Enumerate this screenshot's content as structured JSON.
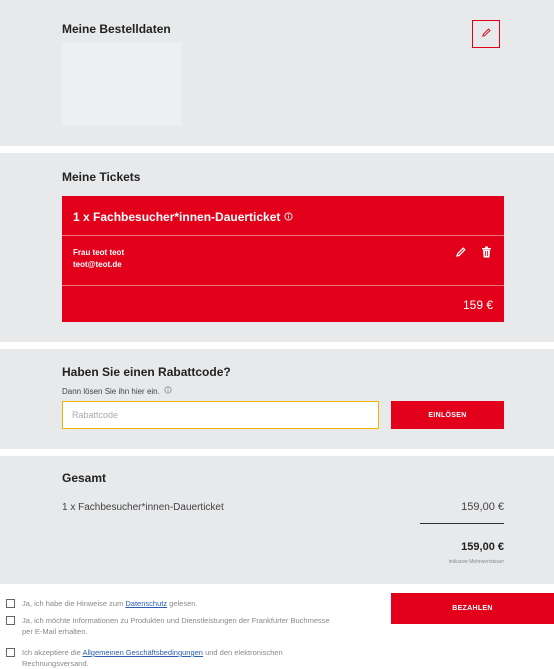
{
  "order_data": {
    "title": "Meine Bestelldaten",
    "edit_icon": "pencil-icon"
  },
  "tickets": {
    "title": "Meine Tickets",
    "ticket_name": "1 x Fachbesucher*innen-Dauerticket",
    "info_icon": "info-icon",
    "attendee_name": "Frau teot teot",
    "attendee_email": "teot@teot.de",
    "price": "159 €",
    "edit_icon": "pencil-icon",
    "delete_icon": "trash-icon"
  },
  "discount": {
    "title": "Haben Sie einen Rabattcode?",
    "subtitle": "Dann lösen Sie ihn hier ein.",
    "placeholder": "Rabattcode",
    "button_label": "EINLÖSEN"
  },
  "total": {
    "title": "Gesamt",
    "line_item": "1 x Fachbesucher*innen-Dauerticket",
    "line_price": "159,00 €",
    "sum": "159,00 €",
    "tax_note": "inklusive Mehrwertsteuer"
  },
  "consents": [
    {
      "before": "Ja, ich habe die Hinweise zum ",
      "link": "Datenschutz",
      "after": " gelesen."
    },
    {
      "before": "Ja, ich möchte Informationen zu Produkten und Dienstleistungen der Frankfurter Buchmesse per E-Mail erhalten.",
      "link": "",
      "after": ""
    },
    {
      "before": "Ich akzeptiere die ",
      "link": "Allgemeinen Geschäftsbedingungen",
      "after": " und den elektronischen Rechnungsversand."
    }
  ],
  "pay_button": "BEZAHLEN",
  "colors": {
    "brand_red": "#e2001a",
    "section_bg": "#e8e9eb",
    "input_focus": "#f0b400"
  }
}
